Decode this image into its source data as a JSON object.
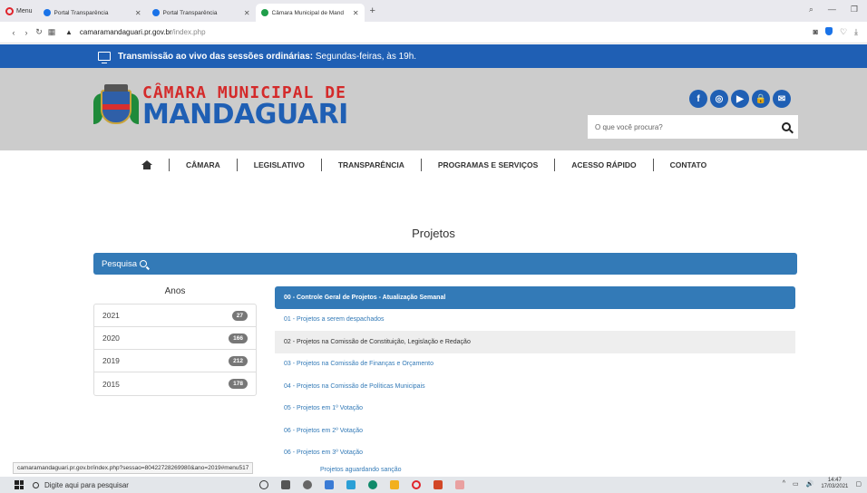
{
  "browser": {
    "menu_label": "Menu",
    "tabs": [
      {
        "title": "Portal Transparência",
        "active": false
      },
      {
        "title": "Portal Transparência",
        "active": false
      },
      {
        "title": "Câmara Municipal de Mand",
        "active": true
      }
    ],
    "new_tab": "+",
    "url_host": "camaramandaguari.pr.gov.br",
    "url_path": "/index.php"
  },
  "banner": {
    "bold": "Transmissão ao vivo das sessões ordinárias:",
    "text": " Segundas-feiras, às 19h."
  },
  "header": {
    "logo_line1": "CÂMARA MUNICIPAL DE",
    "logo_line2": "MANDAGUARI",
    "social": [
      {
        "icon": "facebook-icon",
        "glyph": "f"
      },
      {
        "icon": "instagram-icon",
        "glyph": "◎"
      },
      {
        "icon": "youtube-icon",
        "glyph": "▶"
      },
      {
        "icon": "lock-icon",
        "glyph": "🔒"
      },
      {
        "icon": "mail-icon",
        "glyph": "✉"
      }
    ],
    "search_placeholder": "O que você procura?"
  },
  "nav": {
    "items": [
      "CÂMARA",
      "LEGISLATIVO",
      "TRANSPARÊNCIA",
      "PROGRAMAS E SERVIÇOS",
      "ACESSO RÁPIDO",
      "CONTATO"
    ]
  },
  "main": {
    "title": "Projetos",
    "search_label": "Pesquisa",
    "anos_title": "Anos",
    "anos": [
      {
        "year": "2021",
        "count": "27"
      },
      {
        "year": "2020",
        "count": "166"
      },
      {
        "year": "2019",
        "count": "212"
      },
      {
        "year": "2015",
        "count": "178"
      }
    ],
    "projects": [
      "00 - Controle Geral de Projetos - Atualização Semanal",
      "01 - Projetos a serem despachados",
      "02 - Projetos na Comissão de Constituição, Legislação e Redação",
      "03 - Projetos na Comissão de Finanças e Orçamento",
      "04 - Projetos na Comissão de Políticas Municipais",
      "05 - Projetos em 1º Votação",
      "06 - Projetos em 2º Votação",
      "06 - Projetos em 3º Votação",
      "Projetos aguardando sanção"
    ]
  },
  "status_url": "camaramandaguari.pr.gov.br/index.php?sessao=80422728269980&ano=2019#menu517",
  "taskbar": {
    "search_placeholder": "Digite aqui para pesquisar",
    "time": "14:47",
    "date": "17/03/2021"
  }
}
